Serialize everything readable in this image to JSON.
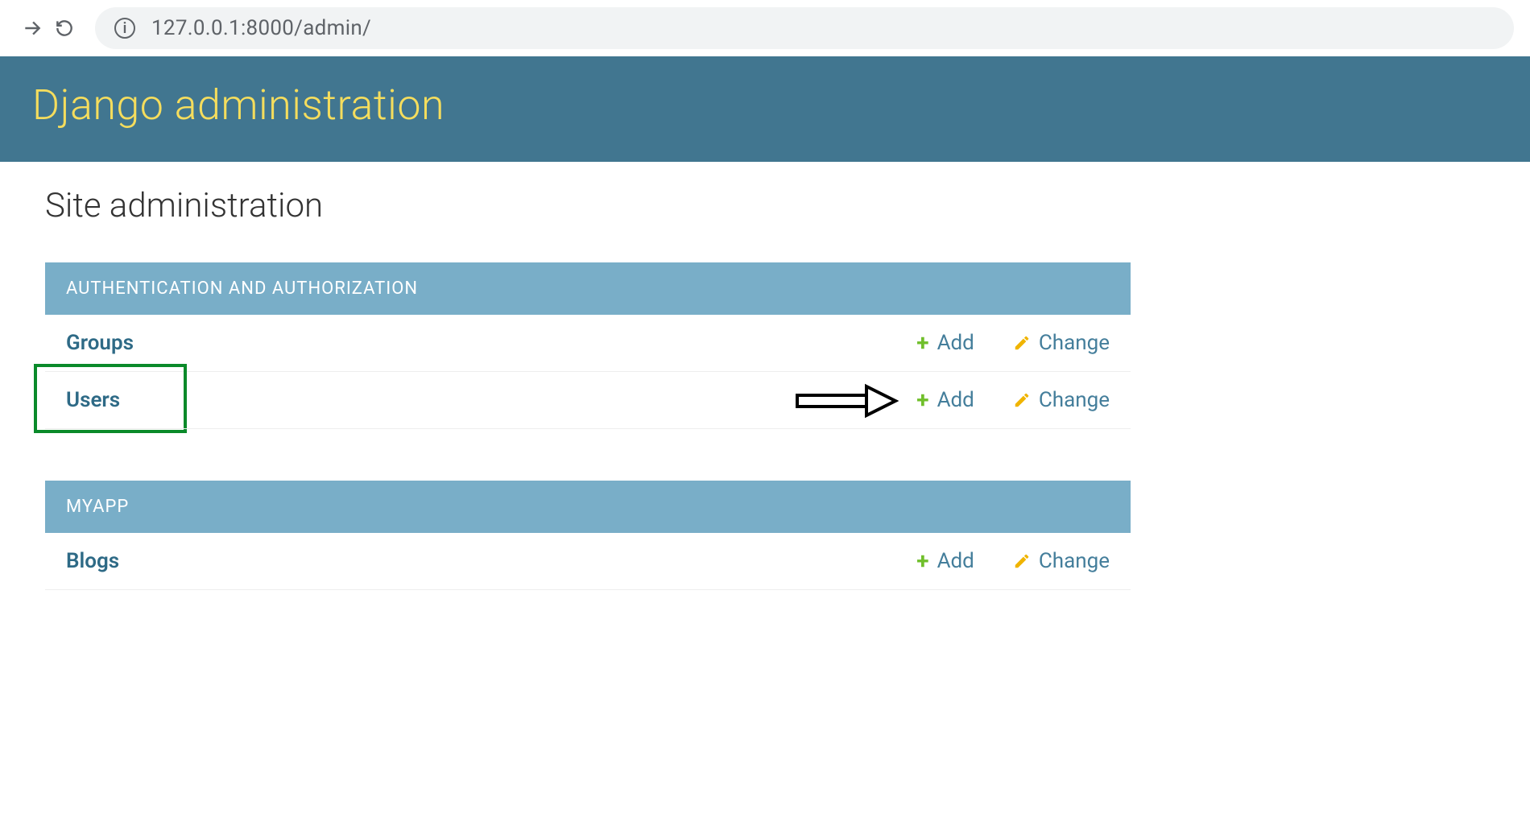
{
  "browser": {
    "url": "127.0.0.1:8000/admin/"
  },
  "header": {
    "title": "Django administration"
  },
  "page": {
    "title": "Site administration"
  },
  "modules": [
    {
      "caption": "AUTHENTICATION AND AUTHORIZATION",
      "models": [
        {
          "name": "Groups",
          "add_label": "Add",
          "change_label": "Change"
        },
        {
          "name": "Users",
          "add_label": "Add",
          "change_label": "Change",
          "highlighted": true,
          "arrow": true
        }
      ]
    },
    {
      "caption": "MYAPP",
      "models": [
        {
          "name": "Blogs",
          "add_label": "Add",
          "change_label": "Change"
        }
      ]
    }
  ]
}
